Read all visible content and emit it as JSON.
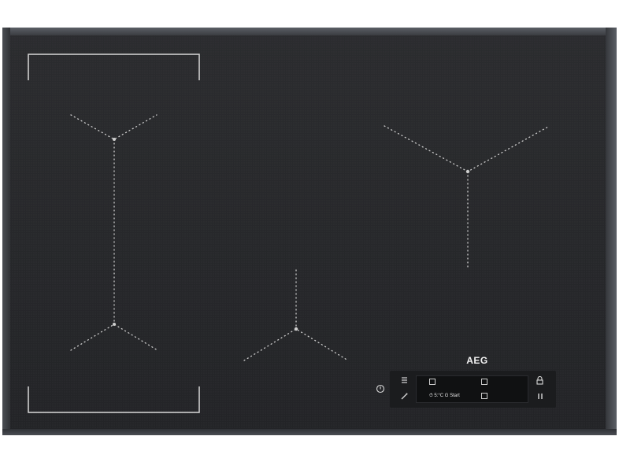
{
  "product": {
    "brand": "AEG",
    "display_text": "⏱ 5:°C  G Start"
  },
  "colors": {
    "glass": "#252629",
    "frame": "#4b4e54",
    "zone_markings": "#d6d6d6",
    "panel_text": "#f2f2f2"
  },
  "controls": {
    "power_icon": "power-icon",
    "menu_icon": "menu-icon",
    "wand_icon": "assist-icon",
    "lock_icon": "lock-icon",
    "pause_icon": "pause-icon"
  }
}
